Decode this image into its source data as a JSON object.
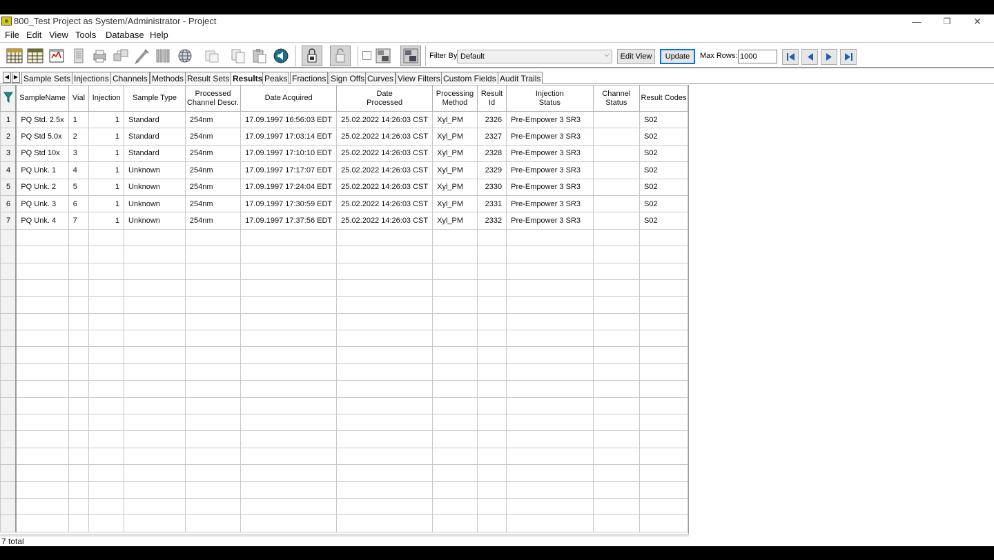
{
  "window": {
    "title": "800_Test Project as System/Administrator - Project",
    "minimize": "—",
    "restore": "❐",
    "close": "✕"
  },
  "menu": [
    "File",
    "Edit",
    "View",
    "Tools",
    "Database",
    "Help"
  ],
  "toolbar": {
    "filter_label": "Filter By:",
    "filter_value": "Default",
    "edit_view": "Edit View",
    "update": "Update",
    "max_rows_label": "Max Rows:",
    "max_rows_value": "1000"
  },
  "tabs": [
    "Sample Sets",
    "Injections",
    "Channels",
    "Methods",
    "Result Sets",
    "Results",
    "Peaks",
    "Fractions",
    "Sign Offs",
    "Curves",
    "View Filters",
    "Custom Fields",
    "Audit Trails"
  ],
  "active_tab": "Results",
  "table": {
    "columns": [
      [
        "SampleName"
      ],
      [
        "Vial"
      ],
      [
        "Injection"
      ],
      [
        "Sample Type"
      ],
      [
        "Processed",
        "Channel Descr."
      ],
      [
        "Date Acquired"
      ],
      [
        "Date",
        "Processed"
      ],
      [
        "Processing",
        "Method"
      ],
      [
        "Result",
        "Id"
      ],
      [
        "Injection",
        "Status"
      ],
      [
        "Channel",
        "Status"
      ],
      [
        "Result Codes"
      ]
    ],
    "rows": [
      [
        "PQ Std. 2.5x",
        "1",
        "1",
        "Standard",
        "254nm",
        "17.09.1997 16:56:03 EDT",
        "25.02.2022 14:26:03 CST",
        "Xyl_PM",
        "2326",
        "Pre-Empower 3 SR3",
        "",
        "S02"
      ],
      [
        "PQ Std 5.0x",
        "2",
        "1",
        "Standard",
        "254nm",
        "17.09.1997 17:03:14 EDT",
        "25.02.2022 14:26:03 CST",
        "Xyl_PM",
        "2327",
        "Pre-Empower 3 SR3",
        "",
        "S02"
      ],
      [
        "PQ Std 10x",
        "3",
        "1",
        "Standard",
        "254nm",
        "17.09.1997 17:10:10 EDT",
        "25.02.2022 14:26:03 CST",
        "Xyl_PM",
        "2328",
        "Pre-Empower 3 SR3",
        "",
        "S02"
      ],
      [
        "PQ Unk. 1",
        "4",
        "1",
        "Unknown",
        "254nm",
        "17.09.1997 17:17:07 EDT",
        "25.02.2022 14:26:03 CST",
        "Xyl_PM",
        "2329",
        "Pre-Empower 3 SR3",
        "",
        "S02"
      ],
      [
        "PQ Unk. 2",
        "5",
        "1",
        "Unknown",
        "254nm",
        "17.09.1997 17:24:04 EDT",
        "25.02.2022 14:26:03 CST",
        "Xyl_PM",
        "2330",
        "Pre-Empower 3 SR3",
        "",
        "S02"
      ],
      [
        "PQ Unk. 3",
        "6",
        "1",
        "Unknown",
        "254nm",
        "17.09.1997 17:30:59 EDT",
        "25.02.2022 14:26:03 CST",
        "Xyl_PM",
        "2331",
        "Pre-Empower 3 SR3",
        "",
        "S02"
      ],
      [
        "PQ Unk. 4",
        "7",
        "1",
        "Unknown",
        "254nm",
        "17.09.1997 17:37:56 EDT",
        "25.02.2022 14:26:03 CST",
        "Xyl_PM",
        "2332",
        "Pre-Empower 3 SR3",
        "",
        "S02"
      ]
    ]
  },
  "status": "7 total"
}
